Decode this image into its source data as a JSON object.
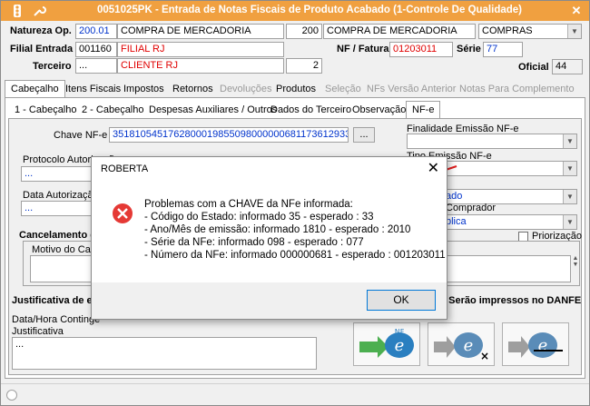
{
  "window": {
    "title": "0051025PK - Entrada de Notas Fiscais de Produto Acabado (1-Controle De Qualidade)",
    "icons": [
      "traffic-light-icon",
      "wrench-icon"
    ],
    "close_glyph": "✕"
  },
  "header": {
    "natureza_label": "Natureza Op.",
    "natureza_code": "200.01",
    "natureza_desc": "COMPRA DE MERCADORIA",
    "natureza_num": "200",
    "natureza_desc2": "COMPRA DE MERCADORIA",
    "natureza_type": "COMPRAS",
    "filial_label": "Filial Entrada",
    "filial_code": "001160",
    "filial_name": "FILIAL RJ",
    "nf_label": "NF / Fatura",
    "nf_value": "01203011",
    "serie_label": "Série",
    "serie_value": "77",
    "terceiro_label": "Terceiro",
    "terceiro_code": "...",
    "terceiro_name": "CLIENTE RJ",
    "terceiro_num": "2",
    "oficial_label": "Oficial",
    "oficial_value": "44"
  },
  "main_tabs": [
    {
      "label": "Cabeçalho",
      "state": "selected"
    },
    {
      "label": "Itens Fiscais",
      "state": "normal"
    },
    {
      "label": "Impostos",
      "state": "normal"
    },
    {
      "label": "Retornos",
      "state": "normal"
    },
    {
      "label": "Devoluções",
      "state": "disabled"
    },
    {
      "label": "Produtos",
      "state": "normal"
    },
    {
      "label": "Seleção",
      "state": "disabled"
    },
    {
      "label": "NFs Versão Anterior",
      "state": "disabled"
    },
    {
      "label": "Notas Para Complemento",
      "state": "disabled"
    }
  ],
  "sub_tabs": [
    {
      "label": "1 - Cabeçalho"
    },
    {
      "label": "2 - Cabeçalho"
    },
    {
      "label": "Despesas Auxiliares / Outros"
    },
    {
      "label": "Dados do Terceiro"
    },
    {
      "label": "Observação"
    },
    {
      "label": "NF-e"
    }
  ],
  "nfe": {
    "chave_label": "Chave NF-e",
    "chave_value": "35181054517628000198550980000006811736129336",
    "chave_btn": "...",
    "protocolo_label": "Protocolo Autorização",
    "protocolo_value": "...",
    "data_autorizacao_label": "Data Autorização",
    "data_autorizacao_value": "...",
    "finalidade_label": "Finalidade Emissão NF-e",
    "tipo_emissao_label": "Tipo Emissão NF-e",
    "partial_value1": "ado",
    "partial_label2": "Comprador",
    "partial_value2": "blica",
    "priorizacao_label": "Priorização",
    "cancelamento_label": "Cancelamento d",
    "motivo_label": "Motivo do Canc",
    "justificativa_section": "Justificativa de e",
    "danfe_label": ". Serão impressos no DANFE",
    "data_contingencia_label": "Data/Hora Contingê",
    "justificativa_label": "Justificativa",
    "justificativa_value": "..."
  },
  "dialog": {
    "title": "ROBERTA",
    "close": "✕",
    "lines": [
      "Problemas com a CHAVE da NFe informada:",
      "- Código do Estado: informado 35 - esperado : 33",
      "- Ano/Mês de emissão: informado 1810 - esperado : 2010",
      "- Série da NFe: informado 098 - esperado : 077",
      "- Número da NFe: informado 000000681 - esperado : 001203011"
    ],
    "ok_label": "OK",
    "icon": "error-icon"
  },
  "nfe_buttons": [
    "nfe-send-icon",
    "nfe-cancel-icon",
    "nfe-disable-icon"
  ],
  "colors": {
    "titlebar": "#f0a040",
    "error_red": "#e53935",
    "arrow_red": "#e02020",
    "link_blue": "#0033cc"
  }
}
